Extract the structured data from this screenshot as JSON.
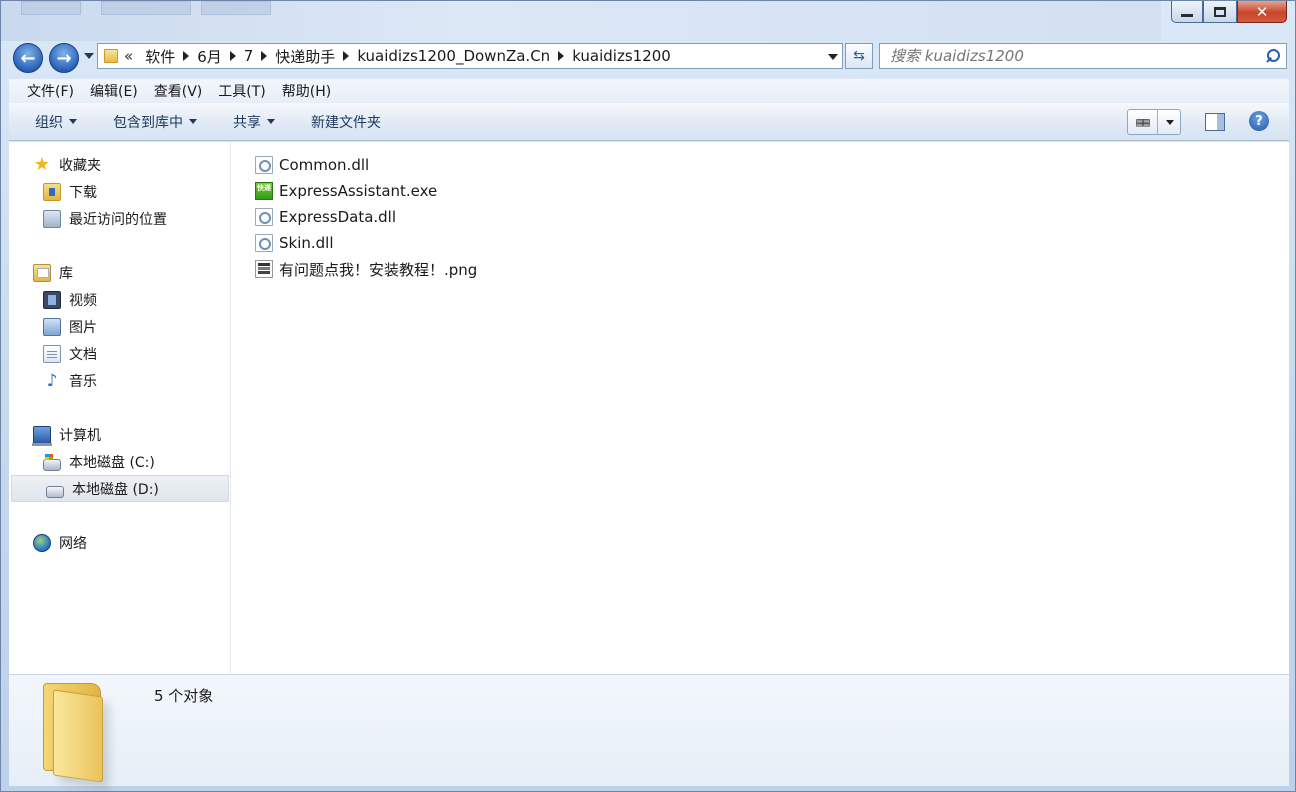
{
  "window": {
    "caption": {
      "minimize": "",
      "maximize": "",
      "close": "✕"
    }
  },
  "nav": {
    "back_label": "←",
    "forward_label": "→",
    "refresh_label": "⇆"
  },
  "address": {
    "overflow": "«",
    "crumbs": [
      "软件",
      "6月",
      "7",
      "快递助手",
      "kuaidizs1200_DownZa.Cn",
      "kuaidizs1200"
    ]
  },
  "search": {
    "placeholder": "搜索 kuaidizs1200"
  },
  "menubar": {
    "items": [
      "文件(F)",
      "编辑(E)",
      "查看(V)",
      "工具(T)",
      "帮助(H)"
    ]
  },
  "commandbar": {
    "organize": "组织",
    "include_library": "包含到库中",
    "share": "共享",
    "new_folder": "新建文件夹",
    "view_icon": "▤▤",
    "help": "?"
  },
  "sidebar": {
    "favorites": {
      "label": "收藏夹",
      "items": [
        "下载",
        "最近访问的位置"
      ]
    },
    "libraries": {
      "label": "库",
      "items": [
        "视频",
        "图片",
        "文档",
        "音乐"
      ]
    },
    "computer": {
      "label": "计算机",
      "items": [
        "本地磁盘 (C:)",
        "本地磁盘 (D:)"
      ]
    },
    "network": {
      "label": "网络"
    }
  },
  "files": [
    {
      "name": "Common.dll",
      "icon": "dll-file-icon"
    },
    {
      "name": "ExpressAssistant.exe",
      "icon": "express-app-icon",
      "icon_text": "快递"
    },
    {
      "name": "ExpressData.dll",
      "icon": "dll-file-icon"
    },
    {
      "name": "Skin.dll",
      "icon": "dll-file-icon"
    },
    {
      "name": "有问题点我！安装教程！.png",
      "icon": "png-image-icon"
    }
  ],
  "details": {
    "status": "5 个对象"
  },
  "colors": {
    "accent": "#2a62b8",
    "selected_row": "#e0e6ee",
    "exe_green": "#2f9a1c"
  }
}
